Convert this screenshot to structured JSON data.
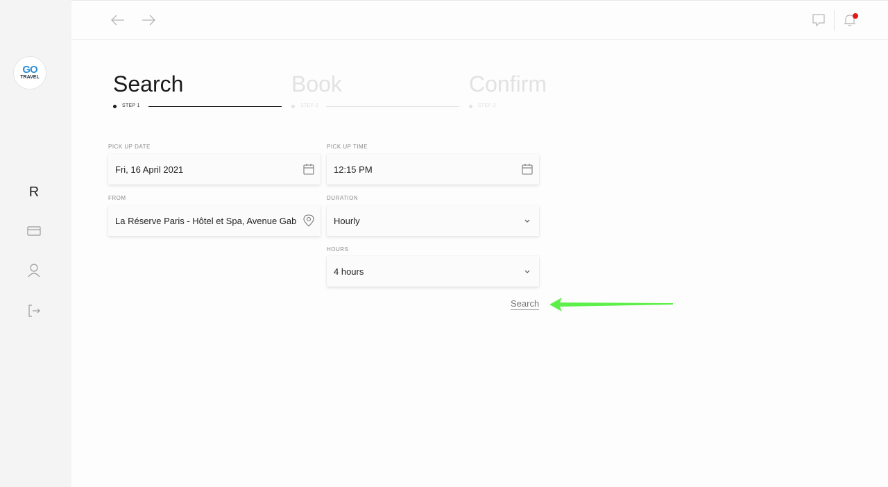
{
  "logo": {
    "main": "GO",
    "sub": "TRAVEL"
  },
  "sidebar": {
    "brand_letter": "R"
  },
  "steps": [
    {
      "title": "Search",
      "label": "STEP 1"
    },
    {
      "title": "Book",
      "label": "STEP 2"
    },
    {
      "title": "Confirm",
      "label": "STEP 3"
    }
  ],
  "form": {
    "pickup_date": {
      "label": "PICK UP DATE",
      "value": "Fri, 16 April 2021"
    },
    "pickup_time": {
      "label": "PICK UP TIME",
      "value": "12:15 PM"
    },
    "from": {
      "label": "FROM",
      "value": "La Réserve Paris - Hôtel et Spa, Avenue Gabriel,"
    },
    "duration": {
      "label": "DURATION",
      "value": "Hourly"
    },
    "hours": {
      "label": "HOURS",
      "value": "4 hours"
    },
    "search_label": "Search"
  },
  "colors": {
    "notification_dot": "#e3161b",
    "annotation_arrow": "#5ef04a",
    "logo_blue": "#2a8fd6"
  }
}
